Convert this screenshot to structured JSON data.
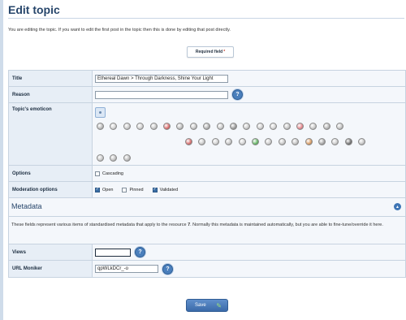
{
  "page": {
    "title": "Edit topic",
    "intro": "You are editing the topic. If you want to edit the first post in the topic then this is done by editing that post directly.",
    "required_label": "Required field",
    "required_mark": "*"
  },
  "form": {
    "title_label": "Title",
    "title_value": "Ethereal Dawn > Through Darkness, Shine Your Light",
    "reason_label": "Reason",
    "reason_value": "",
    "emoticon_label": "Topic's emoticon",
    "emoticons": [
      {
        "color": "#b9b9b9"
      },
      {
        "color": "#d0d0d0"
      },
      {
        "color": "#c8c8c8"
      },
      {
        "color": "#cfcfcf"
      },
      {
        "color": "#c6c6c6"
      },
      {
        "color": "#d96a6a"
      },
      {
        "color": "#bdbdbd"
      },
      {
        "color": "#c4c4c4"
      },
      {
        "color": "#b0b0b0"
      },
      {
        "color": "#c8c8c8"
      },
      {
        "color": "#999999"
      },
      {
        "color": "#c9c9c9"
      },
      {
        "color": "#cdcdcd"
      },
      {
        "color": "#d2d2d2"
      },
      {
        "color": "#c4c4c4"
      },
      {
        "color": "#e5868d"
      },
      {
        "color": "#c9c9c9"
      },
      {
        "color": "#b5b5b5"
      },
      {
        "color": "#c1c1c1"
      },
      {
        "color": "#d46b6b"
      },
      {
        "color": "#c8c8c8"
      },
      {
        "color": "#cfcfcf"
      },
      {
        "color": "#c3c3c3"
      },
      {
        "color": "#d1d1d1"
      },
      {
        "color": "#64b564"
      },
      {
        "color": "#cbcbcb"
      },
      {
        "color": "#c7c7c7"
      },
      {
        "color": "#c2c2c2"
      },
      {
        "color": "#d89b63"
      },
      {
        "color": "#a5a5a5"
      },
      {
        "color": "#cbcbcb"
      },
      {
        "color": "#6f6f6f"
      },
      {
        "color": "#c5c5c5"
      },
      {
        "color": "#c9c9c9"
      },
      {
        "color": "#c0c0c0"
      },
      {
        "color": "#bcbcbc"
      }
    ],
    "options_label": "Options",
    "cascading_label": "Cascading",
    "cascading_checked": false,
    "moderation_label": "Moderation options",
    "open_label": "Open",
    "open_checked": true,
    "pinned_label": "Pinned",
    "pinned_checked": false,
    "validated_label": "Validated",
    "validated_checked": true
  },
  "metadata": {
    "heading": "Metadata",
    "desc_before": "These fields represent various items of standardised metadata that apply to the resource ",
    "resource_id": "7",
    "desc_after": ". Normally this metadata is maintained automatically, but you are able to fine-tune/override it here.",
    "views_label": "Views",
    "views_value": "",
    "moniker_label": "URL Moniker",
    "moniker_value": "qpWLkDCr_-o"
  },
  "actions": {
    "save_label": "Save"
  },
  "icons": {
    "help": "?",
    "collapse": "▲",
    "save_icon": "✎"
  }
}
